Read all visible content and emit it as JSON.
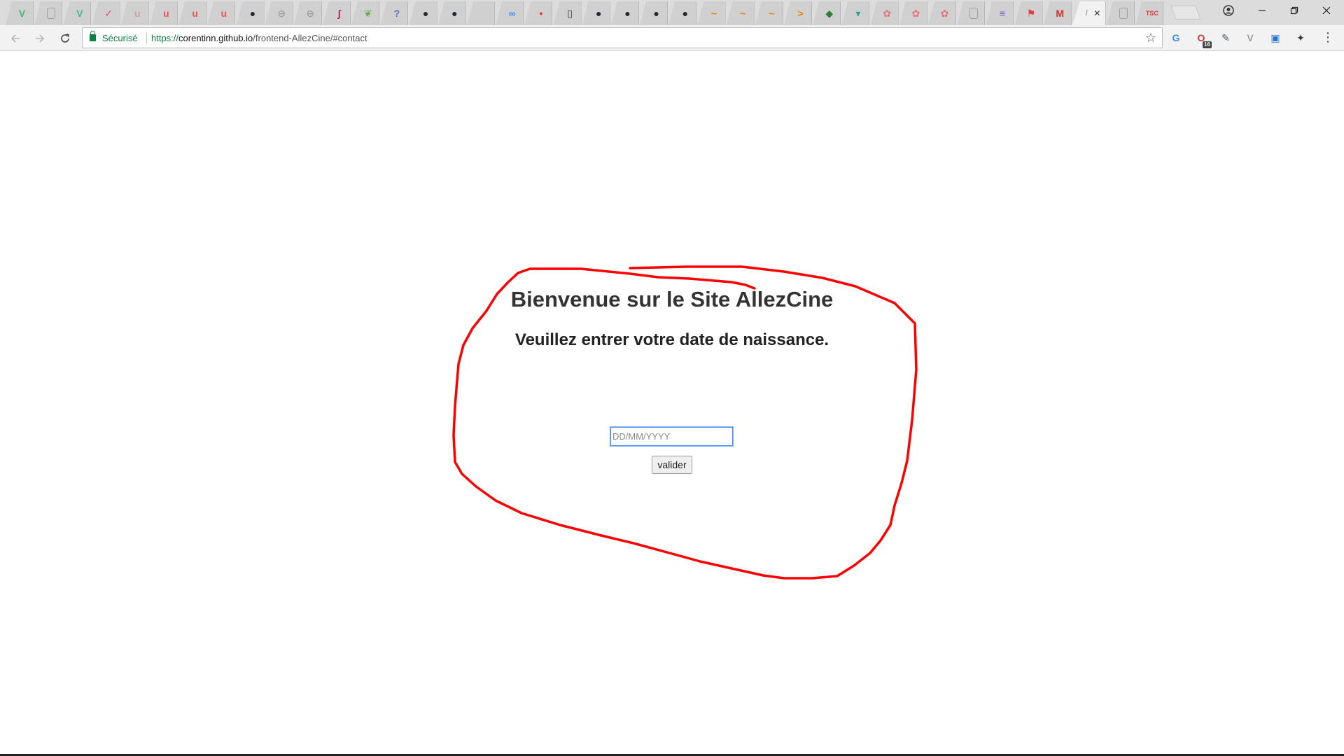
{
  "browser": {
    "tabs": [
      {
        "icon": "vue-icon",
        "color": "#41b883",
        "glyph": "V"
      },
      {
        "icon": "document-icon",
        "color": "#9e9e9e",
        "glyph": ""
      },
      {
        "icon": "vue-icon",
        "color": "#41b883",
        "glyph": "V"
      },
      {
        "icon": "pocket-icon",
        "color": "#ef4056",
        "glyph": "✓"
      },
      {
        "icon": "udemy-icon",
        "color": "#c9a6a6",
        "glyph": "u"
      },
      {
        "icon": "udemy-icon",
        "color": "#ec5252",
        "glyph": "u"
      },
      {
        "icon": "udemy-icon",
        "color": "#ec5252",
        "glyph": "u"
      },
      {
        "icon": "udemy-icon",
        "color": "#ec5252",
        "glyph": "u"
      },
      {
        "icon": "github-icon",
        "color": "#24292e",
        "glyph": "●"
      },
      {
        "icon": "globe-icon",
        "color": "#9e9e9e",
        "glyph": "⊖"
      },
      {
        "icon": "globe-icon",
        "color": "#9e9e9e",
        "glyph": "⊖"
      },
      {
        "icon": "swirl-icon",
        "color": "#c2185b",
        "glyph": "ʃ"
      },
      {
        "icon": "leaf-icon",
        "color": "#6ab04c",
        "glyph": "❦"
      },
      {
        "icon": "question-icon",
        "color": "#5c6bc0",
        "glyph": "?"
      },
      {
        "icon": "github-icon",
        "color": "#24292e",
        "glyph": "●"
      },
      {
        "icon": "github-icon",
        "color": "#24292e",
        "glyph": "●"
      },
      {
        "icon": "blank-icon",
        "color": "#d0d0d0",
        "glyph": ""
      },
      {
        "icon": "link-icon",
        "color": "#4285f4",
        "glyph": "∞"
      },
      {
        "icon": "note-icon",
        "color": "#e53935",
        "glyph": "•"
      },
      {
        "icon": "book-icon",
        "color": "#333333",
        "glyph": "▯"
      },
      {
        "icon": "github-icon",
        "color": "#24292e",
        "glyph": "●"
      },
      {
        "icon": "github-icon",
        "color": "#24292e",
        "glyph": "●"
      },
      {
        "icon": "github-icon",
        "color": "#24292e",
        "glyph": "●"
      },
      {
        "icon": "github-icon",
        "color": "#24292e",
        "glyph": "●"
      },
      {
        "icon": "wave-icon",
        "color": "#f57c00",
        "glyph": "~"
      },
      {
        "icon": "wave-icon",
        "color": "#f57c00",
        "glyph": "~"
      },
      {
        "icon": "wave-icon",
        "color": "#f57c00",
        "glyph": "~"
      },
      {
        "icon": "terminal-icon",
        "color": "#f57c00",
        "glyph": ">"
      },
      {
        "icon": "shield-icon",
        "color": "#2e7d32",
        "glyph": "◆"
      },
      {
        "icon": "bird-icon",
        "color": "#26a69a",
        "glyph": "▾"
      },
      {
        "icon": "brain-icon",
        "color": "#e57373",
        "glyph": "✿"
      },
      {
        "icon": "brain-icon",
        "color": "#e57373",
        "glyph": "✿"
      },
      {
        "icon": "brain-icon",
        "color": "#e57373",
        "glyph": "✿"
      },
      {
        "icon": "document-icon",
        "color": "#9e9e9e",
        "glyph": ""
      },
      {
        "icon": "list-icon",
        "color": "#7e57c2",
        "glyph": "≡"
      },
      {
        "icon": "runner-icon",
        "color": "#e53935",
        "glyph": "⚑"
      },
      {
        "icon": "gmail-icon",
        "color": "#d93025",
        "glyph": "M"
      },
      {
        "icon": "active-tab-icon",
        "color": "#9e9e9e",
        "glyph": "/",
        "active": true
      },
      {
        "icon": "document-icon",
        "color": "#9e9e9e",
        "glyph": ""
      },
      {
        "icon": "tsc-icon",
        "color": "#e53935",
        "glyph": "TSC"
      }
    ],
    "omnibox": {
      "secure_label": "Sécurisé",
      "url_scheme": "https://",
      "url_host": "corentinn.github.io",
      "url_path": "/frontend-AllezCine/#contact"
    },
    "extensions": [
      {
        "icon": "translate-icon",
        "color": "#4285f4",
        "glyph": "G"
      },
      {
        "icon": "adblock-icon",
        "color": "#d32f2f",
        "glyph": "O",
        "badge": "16"
      },
      {
        "icon": "eyedropper-icon",
        "color": "#455a64",
        "glyph": "✎"
      },
      {
        "icon": "vue-devtools-icon",
        "color": "#9e9e9e",
        "glyph": "V"
      },
      {
        "icon": "bookmark-ext-icon",
        "color": "#1976d2",
        "glyph": "▣"
      },
      {
        "icon": "evernote-icon",
        "color": "#333333",
        "glyph": "✦"
      }
    ]
  },
  "page": {
    "heading": "Bienvenue sur le Site AllezCine",
    "subheading": "Veuillez entrer votre date de naissance.",
    "birthdate_placeholder": "DD/MM/YYYY",
    "submit_label": "valider"
  },
  "colors": {
    "annotation": "#ff0000",
    "secure": "#0b8043",
    "focus_border": "#4d90fe"
  }
}
